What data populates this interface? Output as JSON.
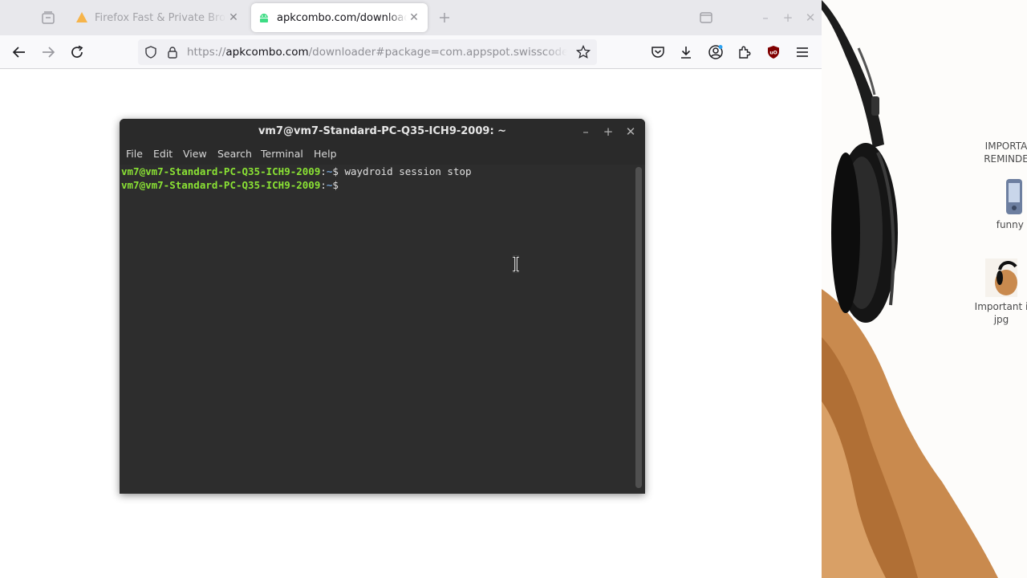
{
  "browser": {
    "tabs": [
      {
        "title": "Firefox Fast & Private Brow",
        "active": false,
        "icon": "firefox-warning-icon"
      },
      {
        "title": "apkcombo.com/downloader",
        "active": true,
        "icon": "android-icon"
      }
    ],
    "url": {
      "scheme": "https://",
      "host": "apkcombo.com",
      "path": "/downloader#package=com.appspot.swisscodemoni"
    },
    "icons": {
      "tab_overview": "tab-overview-icon",
      "new_tab": "plus-icon",
      "back": "back-arrow-icon",
      "forward": "forward-arrow-icon",
      "reload": "reload-icon",
      "tracking": "shield-icon",
      "lock": "lock-icon",
      "bookmark": "star-icon",
      "pocket": "pocket-icon",
      "downloads": "download-icon",
      "account": "account-icon",
      "extensions": "puzzle-icon",
      "ublock": "ublock-icon",
      "menu": "hamburger-menu-icon"
    }
  },
  "terminal": {
    "title": "vm7@vm7-Standard-PC-Q35-ICH9-2009: ~",
    "menu": [
      "File",
      "Edit",
      "View",
      "Search",
      "Terminal",
      "Help"
    ],
    "lines": [
      {
        "user_host": "vm7@vm7-Standard-PC-Q35-ICH9-2009",
        "sep": ":",
        "dir": "~",
        "symbol": "$ ",
        "command": "waydroid session stop"
      },
      {
        "user_host": "vm7@vm7-Standard-PC-Q35-ICH9-2009",
        "sep": ":",
        "dir": "~",
        "symbol": "$ ",
        "command": ""
      }
    ],
    "colors": {
      "prompt_user": "#8ae234",
      "prompt_dir": "#729fcf",
      "background": "#2d2d2d"
    }
  },
  "desktop": {
    "icons": [
      {
        "label_line1": "IMPORTA",
        "label_line2": "REMINDE"
      },
      {
        "label_line1": "funny c",
        "label_line2": ""
      },
      {
        "label_line1": "Important i",
        "label_line2": "jpg"
      }
    ]
  }
}
